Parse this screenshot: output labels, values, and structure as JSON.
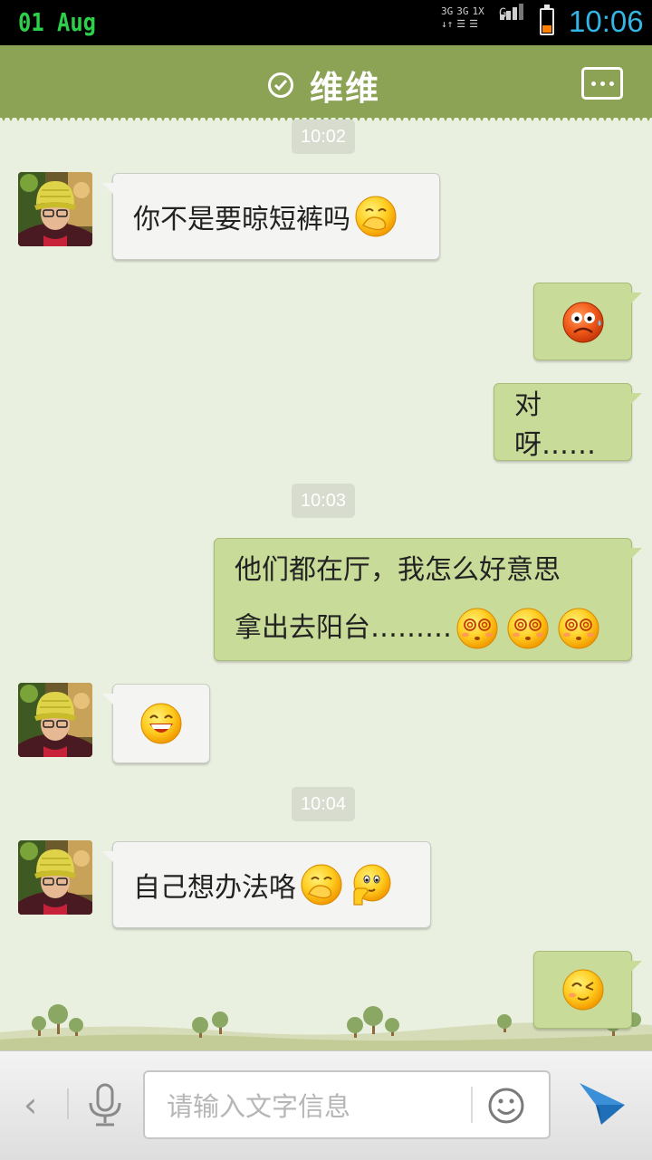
{
  "status_bar": {
    "date": "01 Aug",
    "network_top": [
      "3G",
      "3G",
      "1X"
    ],
    "network_letter": "G",
    "time": "10:06",
    "battery_color": "#ff7f00",
    "time_color": "#33b5e5"
  },
  "header": {
    "title": "维维",
    "verified_icon": "check-circle-icon",
    "menu_icon": "chat-menu-icon",
    "background": "#8ca255"
  },
  "messages": {
    "ts1": "10:02",
    "m1": "你不是要晾短裤吗",
    "m3": "对呀……",
    "ts2": "10:03",
    "m4_line1": "他们都在厅，我怎么好意思",
    "m4_line2": "拿出去阳台………",
    "ts3": "10:04",
    "m6": "自己想办法咯"
  },
  "emoticons": {
    "m1": [
      "covering-mouth-emoji"
    ],
    "m2": [
      "angry-sweat-emoji"
    ],
    "m4": [
      "dizzy-emoji",
      "dizzy-emoji",
      "dizzy-emoji"
    ],
    "m5": [
      "grin-emoji"
    ],
    "m6": [
      "covering-mouth-emoji",
      "thinking-emoji"
    ],
    "m7": [
      "wink-emoji"
    ]
  },
  "input_bar": {
    "placeholder": "请输入文字信息",
    "back_icon": "chevron-left-icon",
    "voice_icon": "microphone-icon",
    "emoji_icon": "smiley-icon",
    "send_icon": "paper-plane-icon"
  }
}
